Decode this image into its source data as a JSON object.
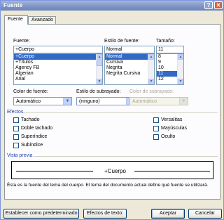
{
  "window": {
    "title": "Fuente",
    "help_glyph": "?",
    "close_glyph": "✕"
  },
  "tabs": [
    "Fuente",
    "Avanzado"
  ],
  "font": {
    "label": "Fuente:",
    "value": "+Cuerpo",
    "items": [
      "+Cuerpo",
      "+Títulos",
      "Agency FB",
      "Algerian",
      "Arial"
    ],
    "selected_index": 0
  },
  "style": {
    "label": "Estilo de fuente:",
    "value": "Normal",
    "items": [
      "Normal",
      "Cursiva",
      "Negrita",
      "Negrita Cursiva"
    ],
    "selected_index": 0
  },
  "size": {
    "label": "Tamaño:",
    "value": "11",
    "items": [
      "8",
      "9",
      "10",
      "11",
      "12"
    ],
    "selected_index": 3
  },
  "font_color": {
    "label": "Color de fuente:",
    "value": "Automático",
    "swatch": "#000000"
  },
  "underline_style": {
    "label": "Estilo de subrayado:",
    "value": "(ninguno)"
  },
  "underline_color": {
    "label": "Color de subrayado:",
    "value": "Automático"
  },
  "effects": {
    "title": "Efectos",
    "left": [
      {
        "label": "Tachado",
        "checked": false
      },
      {
        "label": "Doble tachado",
        "checked": false
      },
      {
        "label": "Superíndice",
        "checked": false
      },
      {
        "label": "Subíndice",
        "checked": false
      }
    ],
    "right": [
      {
        "label": "Versalitas",
        "checked": false
      },
      {
        "label": "Mayúsculas",
        "checked": false
      },
      {
        "label": "Oculto",
        "checked": false
      }
    ]
  },
  "preview": {
    "title": "Vista previa",
    "sample": "+Cuerpo",
    "description": "Ésta es la fuente del tema del cuerpo. El tema del documento actual define qué fuente se utilizará."
  },
  "buttons": {
    "set_default": "Establecer como predeterminado",
    "text_effects": "Efectos de texto:",
    "ok": "Aceptar",
    "cancel": "Cancelar"
  },
  "colors": {
    "title_bar": "#7f95c5",
    "accent_tab": "#f5a623",
    "selection": "#316ac5",
    "group_title": "#1b3fa7"
  }
}
